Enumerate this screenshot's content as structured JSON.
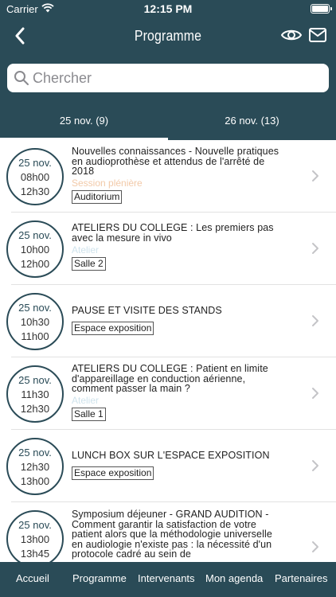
{
  "status": {
    "carrier": "Carrier",
    "time": "12:15 PM"
  },
  "nav": {
    "title": "Programme"
  },
  "search": {
    "placeholder": "Chercher"
  },
  "tabs": [
    {
      "label": "25 nov. (9)"
    },
    {
      "label": "26 nov. (13)"
    }
  ],
  "sessions": [
    {
      "date": "25 nov.",
      "start": "08h00",
      "end": "12h30",
      "title_lines": [
        "Nouvelles connaissances - Nouvelle pratiques",
        "en audioprothèse et attendus de l'arrêté de",
        "2018"
      ],
      "type": "Session plénière",
      "type_color": "#f2c9a8",
      "room": "Auditorium"
    },
    {
      "date": "25 nov.",
      "start": "10h00",
      "end": "12h00",
      "title_lines": [
        "ATELIERS DU COLLEGE : Les premiers pas",
        "avec la mesure in vivo"
      ],
      "type": "Atelier",
      "type_color": "#cfe3ec",
      "room": "Salle 2"
    },
    {
      "date": "25 nov.",
      "start": "10h30",
      "end": "11h00",
      "title_lines": [
        "PAUSE ET VISITE DES STANDS"
      ],
      "type": "",
      "type_color": "",
      "room": "Espace exposition"
    },
    {
      "date": "25 nov.",
      "start": "11h30",
      "end": "12h30",
      "title_lines": [
        "ATELIERS DU COLLEGE : Patient en limite",
        "d'appareillage en conduction aérienne,",
        "comment passer la main ?"
      ],
      "type": "Atelier",
      "type_color": "#cfe3ec",
      "room": "Salle 1"
    },
    {
      "date": "25 nov.",
      "start": "12h30",
      "end": "13h00",
      "title_lines": [
        "LUNCH BOX SUR L'ESPACE EXPOSITION"
      ],
      "type": "",
      "type_color": "",
      "room": "Espace exposition"
    },
    {
      "date": "25 nov.",
      "start": "13h00",
      "end": "13h45",
      "title_lines": [
        "Symposium déjeuner - GRAND AUDITION -",
        "Comment garantir la satisfaction de votre",
        "patient alors que la méthodologie universelle",
        "en audiologie n'existe pas : la nécessité d'un",
        "protocole cadré au sein de"
      ],
      "type": "",
      "type_color": "",
      "room": ""
    }
  ],
  "tabbar": [
    {
      "label": "Accueil"
    },
    {
      "label": "Programme"
    },
    {
      "label": "Intervenants"
    },
    {
      "label": "Mon agenda"
    },
    {
      "label": "Partenaires"
    }
  ],
  "colors": {
    "header": "#2a4b57",
    "accent_session": "#f2c9a8",
    "accent_atelier": "#cfe3ec"
  },
  "icons": {
    "back": "chevron-left-icon",
    "preview": "eye-icon",
    "mail": "mail-icon",
    "search": "search-icon",
    "row": "chevron-right-icon"
  }
}
